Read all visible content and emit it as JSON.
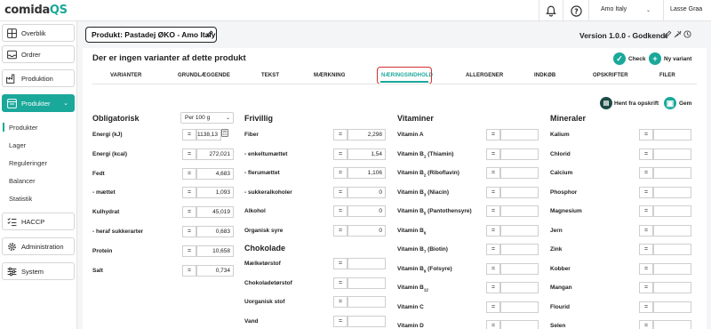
{
  "app": {
    "logo_main": "comida",
    "logo_accent": "QS",
    "company": "Amo Italy",
    "user": "Lasse Graa"
  },
  "sidebar": {
    "items": [
      {
        "label": "Overblik",
        "icon": "grid-icon"
      },
      {
        "label": "Ordrer",
        "icon": "inbox-icon"
      },
      {
        "label": "Produktion",
        "icon": "factory-icon"
      },
      {
        "label": "Produkter",
        "icon": "products-icon",
        "active": true
      },
      {
        "label": "HACCP",
        "icon": "checklist-icon"
      },
      {
        "label": "Administration",
        "icon": "gear-icon"
      },
      {
        "label": "System",
        "icon": "sliders-icon"
      }
    ],
    "sub_items": [
      "Produkter",
      "Lager",
      "Reguleringer",
      "Balancer",
      "Statistik"
    ]
  },
  "header": {
    "product_title": "Produkt: Pastadej ØKO - Amo Italy",
    "version": "Version 1.0.0 - Godkendt"
  },
  "main": {
    "no_variants": "Der er ingen varianter af dette produkt",
    "check_label": "Check",
    "new_variant_label": "Ny variant",
    "fetch_recipe_label": "Hent fra opskrift",
    "save_label": "Gem"
  },
  "tabs": [
    "VARIANTER",
    "GRUNDLÆGGENDE",
    "TEKST",
    "MÆRKNING",
    "NÆRINGSINDHOLD",
    "ALLERGENER",
    "INDKØB",
    "OPSKRIFTER",
    "FILER"
  ],
  "active_tab": "NÆRINGSINDHOLD",
  "obligatorisk": {
    "title": "Obligatorisk",
    "unit_select": "Per 100 g",
    "rows": [
      {
        "label": "Energi (kJ)",
        "op": "=",
        "value": "1138,13"
      },
      {
        "label": "Energi (kcal)",
        "op": "=",
        "value": "272,021"
      },
      {
        "label": "Fedt",
        "op": "=",
        "value": "4,683"
      },
      {
        "label": "- mættet",
        "op": "=",
        "value": "1,093"
      },
      {
        "label": "Kulhydrat",
        "op": "=",
        "value": "45,019"
      },
      {
        "label": "- heraf sukkerarter",
        "op": "=",
        "value": "0,683"
      },
      {
        "label": "Protein",
        "op": "=",
        "value": "10,658"
      },
      {
        "label": "Salt",
        "op": "=",
        "value": "0,734"
      }
    ]
  },
  "frivillig": {
    "title": "Frivillig",
    "rows": [
      {
        "label": "Fiber",
        "op": "=",
        "value": "2,298"
      },
      {
        "label": "- enkeltumættet",
        "op": "=",
        "value": "1,54"
      },
      {
        "label": "- flerumættet",
        "op": "=",
        "value": "1,106"
      },
      {
        "label": "- sukkeralkoholer",
        "op": "=",
        "value": "0"
      },
      {
        "label": "Alkohol",
        "op": "=",
        "value": "0"
      },
      {
        "label": "Organisk syre",
        "op": "=",
        "value": "0"
      }
    ]
  },
  "chokolade": {
    "title": "Chokolade",
    "rows": [
      {
        "label": "Mælketørstof",
        "op": "=",
        "value": ""
      },
      {
        "label": "Chokoladetørstof",
        "op": "=",
        "value": ""
      },
      {
        "label": "Uorganisk stof",
        "op": "=",
        "value": ""
      },
      {
        "label": "Vand",
        "op": "=",
        "value": ""
      }
    ]
  },
  "vitaminer": {
    "title": "Vitaminer",
    "rows": [
      {
        "label": "Vitamin A",
        "sub": "",
        "suffix": "",
        "op": "=",
        "value": ""
      },
      {
        "label": "Vitamin B",
        "sub": "1",
        "suffix": " (Thiamin)",
        "op": "=",
        "value": ""
      },
      {
        "label": "Vitamin B",
        "sub": "2",
        "suffix": " (Riboflavin)",
        "op": "=",
        "value": ""
      },
      {
        "label": "Vitamin B",
        "sub": "3",
        "suffix": " (Niacin)",
        "op": "=",
        "value": ""
      },
      {
        "label": "Vitamin B",
        "sub": "5",
        "suffix": " (Pantothensyre)",
        "op": "=",
        "value": ""
      },
      {
        "label": "Vitamin B",
        "sub": "6",
        "suffix": "",
        "op": "=",
        "value": ""
      },
      {
        "label": "Vitamin B",
        "sub": "7",
        "suffix": " (Biotin)",
        "op": "=",
        "value": ""
      },
      {
        "label": "Vitamin B",
        "sub": "9",
        "suffix": " (Folsyre)",
        "op": "=",
        "value": ""
      },
      {
        "label": "Vitamin B",
        "sub": "12",
        "suffix": "",
        "op": "=",
        "value": ""
      },
      {
        "label": "Vitamin C",
        "sub": "",
        "suffix": "",
        "op": "=",
        "value": ""
      },
      {
        "label": "Vitamin D",
        "sub": "",
        "suffix": "",
        "op": "=",
        "value": ""
      }
    ]
  },
  "mineraler": {
    "title": "Mineraler",
    "rows": [
      {
        "label": "Kalium",
        "op": "=",
        "value": ""
      },
      {
        "label": "Chlorid",
        "op": "=",
        "value": ""
      },
      {
        "label": "Calcium",
        "op": "=",
        "value": ""
      },
      {
        "label": "Phosphor",
        "op": "=",
        "value": ""
      },
      {
        "label": "Magnesium",
        "op": "=",
        "value": ""
      },
      {
        "label": "Jern",
        "op": "=",
        "value": ""
      },
      {
        "label": "Zink",
        "op": "=",
        "value": ""
      },
      {
        "label": "Kobber",
        "op": "=",
        "value": ""
      },
      {
        "label": "Mangan",
        "op": "=",
        "value": ""
      },
      {
        "label": "Flourid",
        "op": "=",
        "value": ""
      },
      {
        "label": "Selen",
        "op": "=",
        "value": ""
      }
    ]
  },
  "colors": {
    "accent": "#1aa89a",
    "dark_accent": "#1d4a45",
    "highlight": "#d32f2f"
  }
}
